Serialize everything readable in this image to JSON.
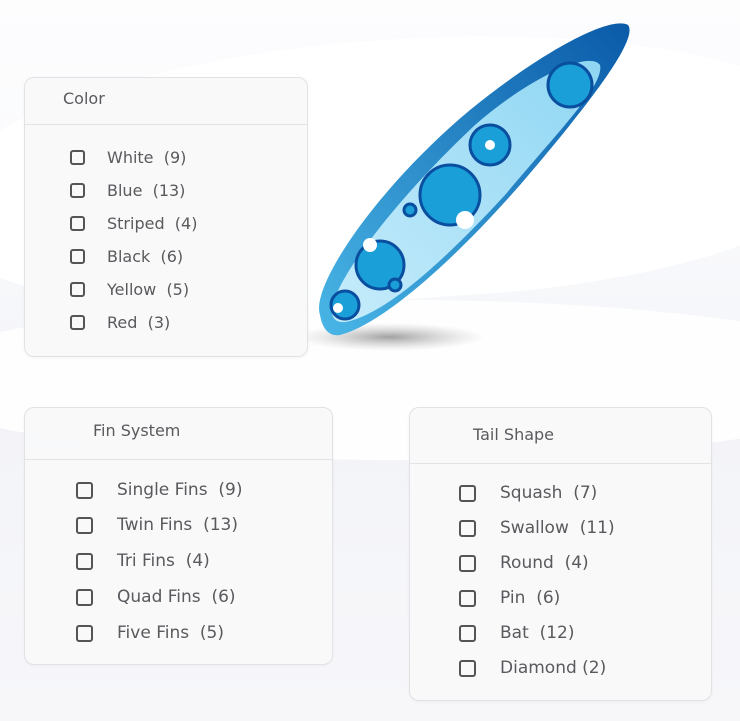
{
  "filters": {
    "color": {
      "title": "Color",
      "options": [
        {
          "label": "White",
          "count": "(9)",
          "checked": false
        },
        {
          "label": "Blue",
          "count": "(13)",
          "checked": false
        },
        {
          "label": "Striped",
          "count": "(4)",
          "checked": false
        },
        {
          "label": "Black",
          "count": "(6)",
          "checked": false
        },
        {
          "label": "Yellow",
          "count": "(5)",
          "checked": false
        },
        {
          "label": "Red",
          "count": "(3)",
          "checked": false
        }
      ]
    },
    "fin_system": {
      "title": "Fin System",
      "options": [
        {
          "label": "Single Fins",
          "count": "(9)",
          "checked": false
        },
        {
          "label": "Twin Fins",
          "count": "(13)",
          "checked": false
        },
        {
          "label": "Tri Fins",
          "count": "(4)",
          "checked": false
        },
        {
          "label": "Quad Fins",
          "count": "(6)",
          "checked": false
        },
        {
          "label": "Five Fins",
          "count": "(5)",
          "checked": false
        }
      ]
    },
    "tail_shape": {
      "title": "Tail Shape",
      "options": [
        {
          "label": "Squash",
          "count": "(7)",
          "checked": false
        },
        {
          "label": "Swallow",
          "count": "(11)",
          "checked": false
        },
        {
          "label": "Round",
          "count": "(4)",
          "checked": false
        },
        {
          "label": "Pin",
          "count": "(6)",
          "checked": false
        },
        {
          "label": "Bat",
          "count": "(12)",
          "checked": false
        },
        {
          "label": "Diamond",
          "count": "(2)",
          "checked": false
        }
      ]
    }
  },
  "illustration": {
    "subject": "surfboard-with-floral-pattern",
    "colors": {
      "dark": "#0a4ea0",
      "mid": "#1a9fd8",
      "light": "#7fd3f2"
    }
  }
}
